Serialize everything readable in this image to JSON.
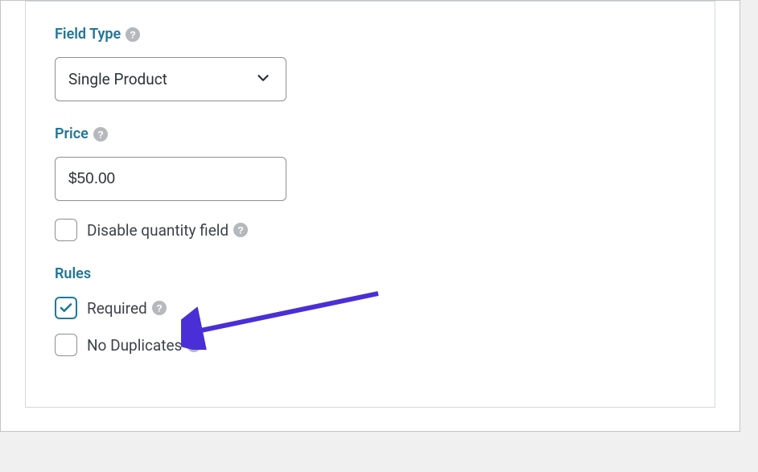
{
  "field_type": {
    "label": "Field Type",
    "selected": "Single Product"
  },
  "price": {
    "label": "Price",
    "value": "$50.00"
  },
  "disable_quantity": {
    "label": "Disable quantity field",
    "checked": false
  },
  "rules": {
    "label": "Rules",
    "required": {
      "label": "Required",
      "checked": true
    },
    "no_duplicates": {
      "label": "No Duplicates",
      "checked": false
    }
  }
}
